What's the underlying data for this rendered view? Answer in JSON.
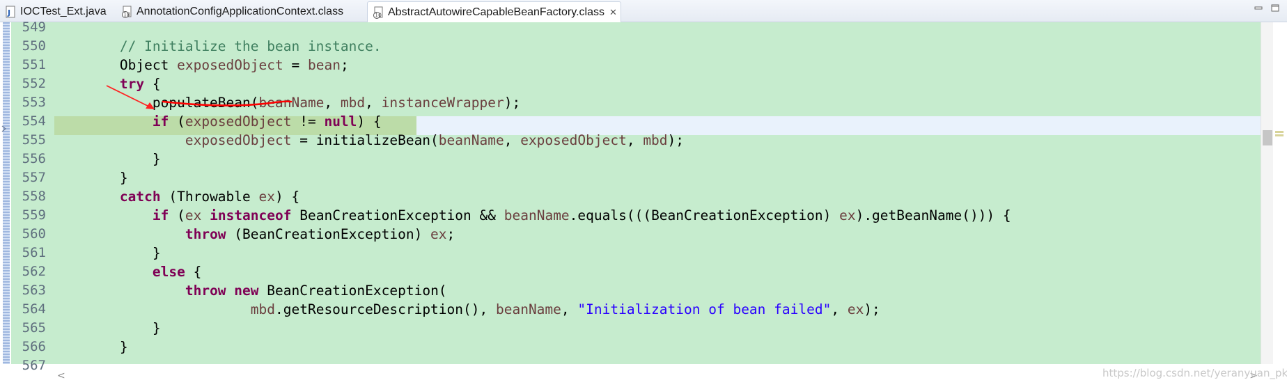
{
  "tabs": [
    {
      "label": "IOCTest_Ext.java",
      "icon": "java-file-icon",
      "active": false
    },
    {
      "label": "AnnotationConfigApplicationContext.class",
      "icon": "class-file-icon",
      "active": false
    },
    {
      "label": "AbstractAutowireCapableBeanFactory.class",
      "icon": "class-file-icon",
      "active": true,
      "close": "✕"
    }
  ],
  "window_controls": [
    "minimize-icon",
    "maximize-icon"
  ],
  "editor": {
    "line_numbers": [
      "549",
      "550",
      "551",
      "552",
      "553",
      "554",
      "555",
      "556",
      "557",
      "558",
      "559",
      "560",
      "561",
      "562",
      "563",
      "564",
      "565",
      "566",
      "567"
    ],
    "highlighted_line": "554",
    "background_color": "#c6ecce",
    "current_line_color": "#e9f2fc",
    "keyword_color": "#7f0055",
    "string_color": "#2a00ff",
    "comment_color": "#3f7f5f",
    "field_color": "#6a3e3e"
  },
  "scroll": {
    "left_arrow": "<",
    "right_arrow": ">"
  },
  "annotation": {
    "arrow_color": "#ff0000",
    "underlined_method": "populateBean",
    "pointed_line": "554"
  },
  "watermark": "https://blog.csdn.net/yeranyuan_pku"
}
